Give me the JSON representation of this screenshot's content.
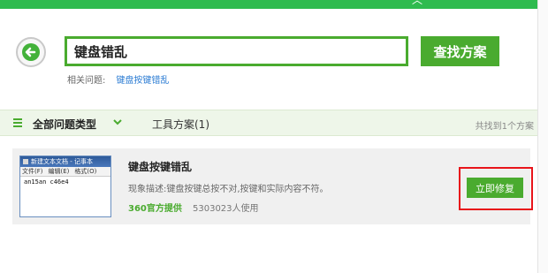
{
  "search": {
    "query": "键盘错乱",
    "button_label": "查找方案",
    "related_label": "相关问题:",
    "related_link": "键盘按键错乱"
  },
  "filter": {
    "all_types_label": "全部问题类型",
    "tool_tab_label": "工具方案(1)",
    "result_count": "共找到1个方案"
  },
  "result": {
    "title": "键盘按键错乱",
    "description": "现象描述:键盘按键总按不对,按键和实际内容不符。",
    "source": "360官方提供",
    "users": "5303023人使用",
    "fix_button_label": "立即修复",
    "thumbnail": {
      "window_title": "新建文本文档 - 记事本",
      "menu_items": [
        "文件(F)",
        "编辑(E)",
        "格式(O)"
      ],
      "content": "an15an c46e4"
    }
  },
  "icons": {
    "back": "back-arrow-icon",
    "filter": "filter-menu-icon",
    "chevron": "chevron-down-icon"
  },
  "colors": {
    "brand_green": "#4aab2f",
    "highlight_red": "#e8141a",
    "link_blue": "#2a7bd3"
  }
}
